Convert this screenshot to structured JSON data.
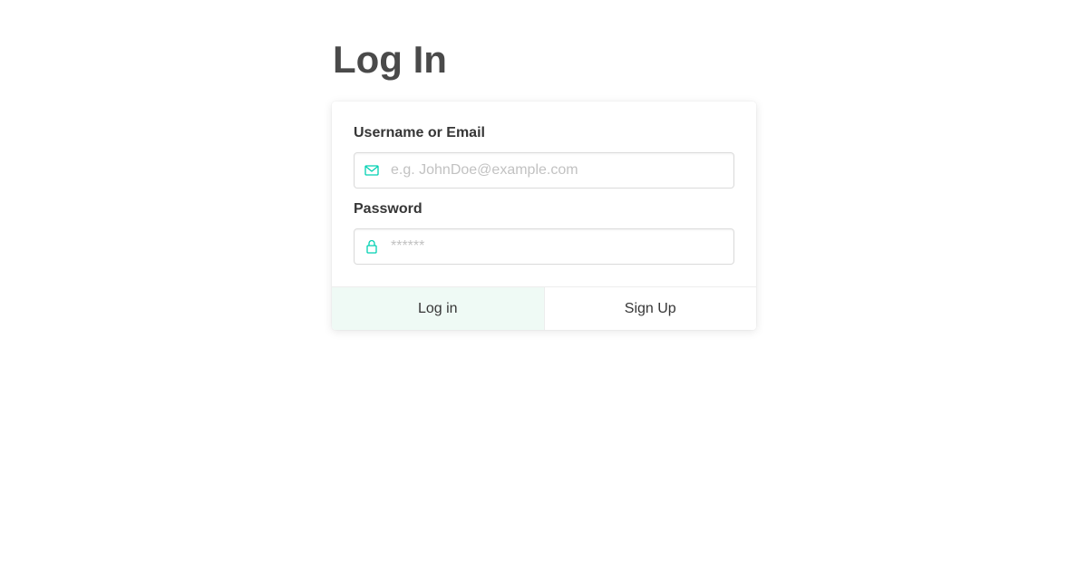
{
  "page": {
    "title": "Log In"
  },
  "form": {
    "username": {
      "label": "Username or Email",
      "placeholder": "e.g. JohnDoe@example.com",
      "value": "",
      "icon": "envelope-icon"
    },
    "password": {
      "label": "Password",
      "placeholder": "******",
      "value": "",
      "icon": "lock-icon"
    }
  },
  "actions": {
    "login_label": "Log in",
    "signup_label": "Sign Up"
  },
  "colors": {
    "accent": "#00d1b2",
    "login_bg": "#effaf5",
    "title": "#4a4a4a"
  }
}
